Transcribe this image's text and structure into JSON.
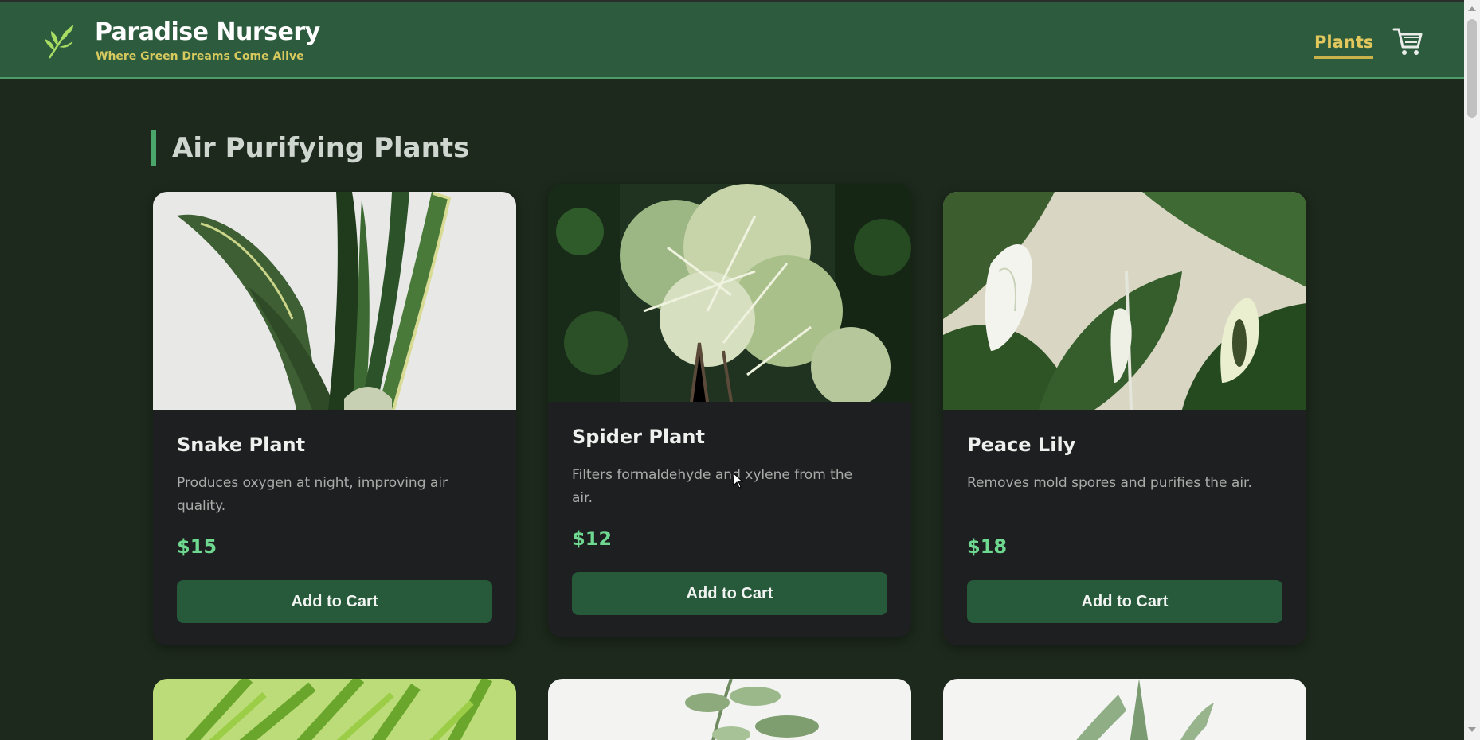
{
  "header": {
    "brand_title": "Paradise Nursery",
    "brand_tagline": "Where Green Dreams Come Alive",
    "logo_icon": "leaf-sprig-icon",
    "nav_plants_label": "Plants",
    "cart_icon": "shopping-cart-icon"
  },
  "section": {
    "title": "Air Purifying Plants"
  },
  "products": [
    {
      "name": "Snake Plant",
      "description": "Produces oxygen at night, improving air quality.",
      "price": "$15",
      "button_label": "Add to Cart"
    },
    {
      "name": "Spider Plant",
      "description": "Filters formaldehyde and xylene from the air.",
      "price": "$12",
      "button_label": "Add to Cart"
    },
    {
      "name": "Peace Lily",
      "description": "Removes mold spores and purifies the air.",
      "price": "$18",
      "button_label": "Add to Cart"
    }
  ],
  "colors": {
    "header_bg": "#2c5b3e",
    "page_bg": "#1d291c",
    "accent_gold": "#e1c75c",
    "price_green": "#6fd890",
    "button_bg": "#265a3a",
    "card_bg": "#1e1f20"
  }
}
